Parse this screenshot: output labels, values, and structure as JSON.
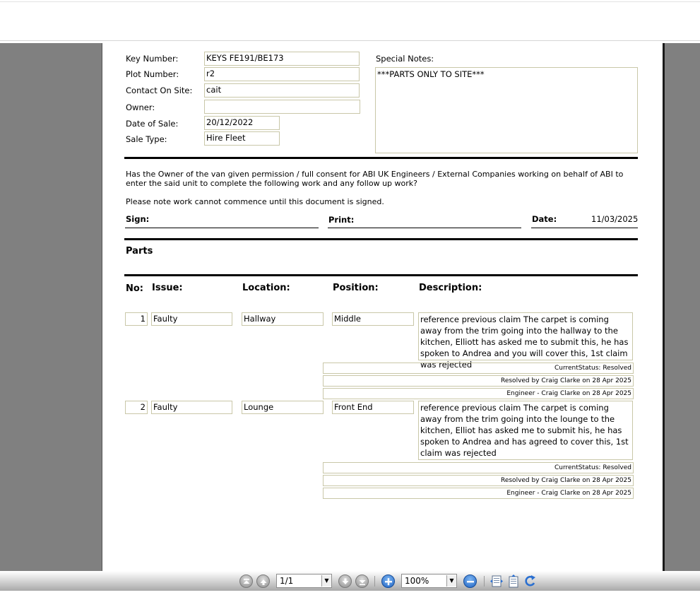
{
  "form": {
    "key_number_label": "Key Number:",
    "key_number_value": "KEYS  FE191/BE173",
    "plot_number_label": "Plot Number:",
    "plot_number_value": "r2",
    "contact_label": "Contact On Site:",
    "contact_value": "cait",
    "owner_label": "Owner:",
    "owner_value": "",
    "date_of_sale_label": "Date of Sale:",
    "date_of_sale_value": "20/12/2022",
    "sale_type_label": "Sale Type:",
    "sale_type_value": "Hire Fleet",
    "special_notes_label": "Special Notes:",
    "special_notes_value": "***PARTS ONLY TO SITE***"
  },
  "consent": {
    "question": "Has the Owner of the van given permission / full consent for ABI UK Engineers / External Companies working on behalf of ABI to enter the said unit to complete the following work and any follow up work?",
    "note": "Please note work cannot commence until this document is signed.",
    "sign_label": "Sign:",
    "print_label": "Print:",
    "date_label": "Date:",
    "date_value": "11/03/2025"
  },
  "parts": {
    "title": "Parts",
    "headers": {
      "no": "No:",
      "issue": "Issue:",
      "location": "Location:",
      "position": "Position:",
      "description": "Description:"
    },
    "rows": [
      {
        "no": "1",
        "issue": "Faulty",
        "location": "Hallway",
        "position": "Middle",
        "description": "reference previous claim The carpet is coming away from the trim going into the hallway to the kitchen, Elliott has asked me to submit this, he has spoken to Andrea and you will cover this, 1st claim was rejected",
        "status": "CurrentStatus: Resolved",
        "resolved": "Resolved by Craig Clarke on 28 Apr 2025",
        "engineer": "Engineer - Craig Clarke on 28 Apr 2025"
      },
      {
        "no": "2",
        "issue": "Faulty",
        "location": "Lounge",
        "position": "Front End",
        "description": "reference previous claim The carpet is coming away from the trim going into the lounge to the kitchen, Elliot has asked me to submit his, he has spoken to Andrea and has agreed to cover this, 1st claim was rejected",
        "status": "CurrentStatus: Resolved",
        "resolved": "Resolved by Craig Clarke on 28 Apr 2025",
        "engineer": "Engineer - Craig Clarke on 28 Apr 2025"
      }
    ]
  },
  "toolbar": {
    "page_value": "1/1",
    "zoom_value": "100%",
    "dropdown_glyph": "▼",
    "accent_color": "#2a6fd0"
  }
}
